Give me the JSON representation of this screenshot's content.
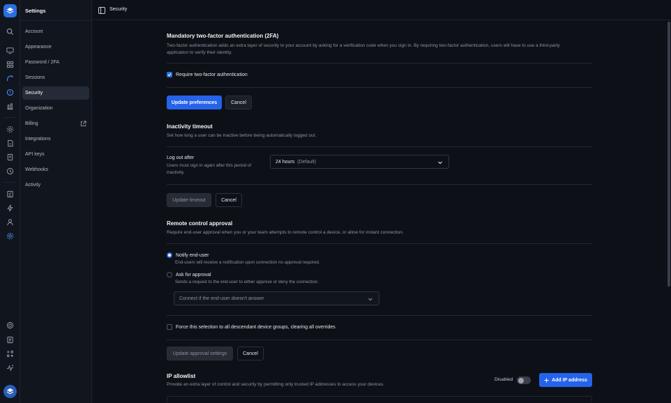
{
  "rail": {
    "icons": [
      "search-icon",
      "monitor-icon",
      "grid-icon",
      "antenna-icon",
      "alert-icon",
      "chart-icon",
      "gear-shield-icon",
      "report-icon",
      "document-icon",
      "history-icon",
      "checklist-icon",
      "lightning-icon",
      "user-icon",
      "settings-icon",
      "support-icon",
      "notes-icon",
      "integrations-icon",
      "activity-icon"
    ]
  },
  "sidebar": {
    "title": "Settings",
    "items": [
      {
        "label": "Account"
      },
      {
        "label": "Appearance"
      },
      {
        "label": "Password / 2FA"
      },
      {
        "label": "Sessions"
      },
      {
        "label": "Security"
      },
      {
        "label": "Organization"
      },
      {
        "label": "Billing"
      },
      {
        "label": "Integrations"
      },
      {
        "label": "API keys"
      },
      {
        "label": "Webhooks"
      },
      {
        "label": "Activity"
      }
    ]
  },
  "topbar": {
    "breadcrumb": "Security"
  },
  "twofa": {
    "title": "Mandatory two-factor authentication (2FA)",
    "desc_line1": "Two-factor authentication adds an extra layer of security to your account by asking for a verification code when you sign in. By requiring two-factor authentication, users will have to use a third-party",
    "desc_line2": "application to verify their identity.",
    "checkbox_label": "Require two-factor authentication",
    "update_button": "Update preferences",
    "cancel_button": "Cancel"
  },
  "inactivity": {
    "title": "Inactivity timeout",
    "desc": "Set how long a user can be inactive before being automatically logged out.",
    "field_label": "Log out after",
    "field_help_line1": "Users must sign in again after this period of",
    "field_help_line2": "inactivity.",
    "select_value": "24 hours",
    "select_muted": "(Default)",
    "update_button": "Update timeout",
    "cancel_button": "Cancel"
  },
  "remote": {
    "title": "Remote control approval",
    "desc": "Require end-user approval when you or your team attempts to remote control a device, or allow for instant connection.",
    "option1_label": "Notify end-user",
    "option1_desc": "End-users will receive a notification upon connection no approval required.",
    "option2_label": "Ask for approval",
    "option2_desc": "Sends a request to the end-user to either approve or deny the connection.",
    "select_placeholder": "Connect if the end-user doesn't answer",
    "force_label": "Force this selection to all descendant device groups, clearing all overrides",
    "update_button": "Update approval settings",
    "cancel_button": "Cancel"
  },
  "ipallow": {
    "title": "IP allowlist",
    "desc": "Provide an extra layer of control and security by permitting only trusted IP addresses to access your devices.",
    "toggle_label": "Disabled",
    "add_button": "Add IP address"
  },
  "colors": {
    "accent": "#2563eb",
    "background": "#0d1017",
    "sidebar": "#11151d"
  }
}
